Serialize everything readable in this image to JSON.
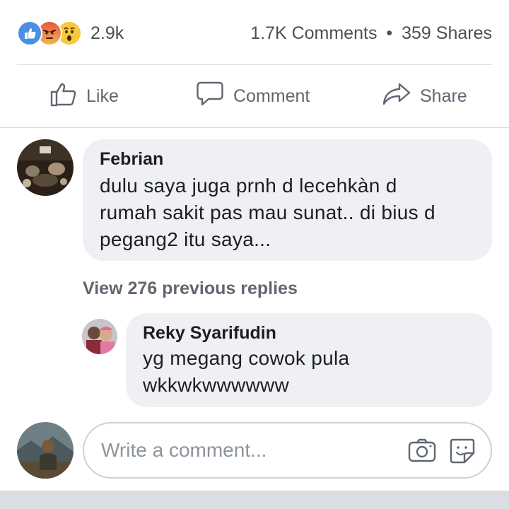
{
  "stats": {
    "reaction_icons": [
      "like-reaction-icon",
      "angry-reaction-icon",
      "wow-reaction-icon"
    ],
    "reaction_count": "2.9k",
    "comments": "1.7K Comments",
    "separator": "•",
    "shares": "359 Shares"
  },
  "actions": {
    "like": "Like",
    "comment": "Comment",
    "share": "Share"
  },
  "comments": [
    {
      "author": "Febrian",
      "text": "dulu saya juga prnh d lecehkàn d\nrumah sakit pas mau sunat.. di bius d\npegang2 itu saya..."
    }
  ],
  "view_replies": "View 276 previous replies",
  "replies": [
    {
      "author": "Reky Syarifudin",
      "text": "yg megang cowok pula\nwkkwkwwwwww"
    }
  ],
  "composer": {
    "placeholder": "Write a comment..."
  },
  "colors": {
    "accent_like": "#4a90e2",
    "bubble_bg": "#eef0f3",
    "muted_text": "#606770"
  }
}
